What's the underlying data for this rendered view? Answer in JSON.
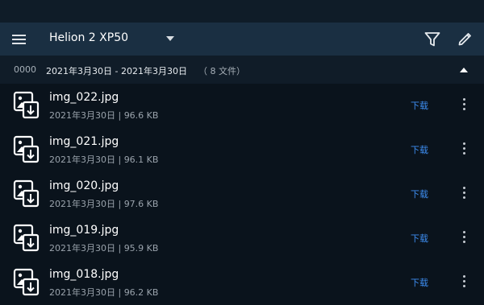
{
  "appbar": {
    "device_name": "Helion 2 XP50",
    "icons": [
      "menu-icon",
      "dropdown-icon",
      "filter-icon",
      "pencil-icon"
    ]
  },
  "group": {
    "id": "0000",
    "date_range": "2021年3月30日 - 2021年3月30日",
    "count": "（ 8 文件）"
  },
  "files": [
    {
      "name": "img_022.jpg",
      "meta": "2021年3月30日 | 96.6 KB",
      "action": "下载"
    },
    {
      "name": "img_021.jpg",
      "meta": "2021年3月30日 | 96.1 KB",
      "action": "下载"
    },
    {
      "name": "img_020.jpg",
      "meta": "2021年3月30日 | 97.6 KB",
      "action": "下载"
    },
    {
      "name": "img_019.jpg",
      "meta": "2021年3月30日 | 95.9 KB",
      "action": "下载"
    },
    {
      "name": "img_018.jpg",
      "meta": "2021年3月30日 | 96.2 KB",
      "action": "下载"
    }
  ],
  "colors": {
    "background": "#0a131c",
    "appbar": "#1a2f42",
    "group_header": "#101c28",
    "accent": "#3d8df0"
  }
}
